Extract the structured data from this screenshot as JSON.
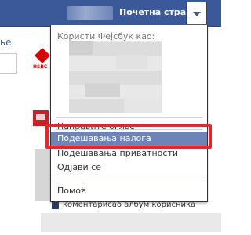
{
  "topbar": {
    "home_label": "Почетна страна",
    "colors": {
      "bar": "#3b5998",
      "text": "#ffffff"
    }
  },
  "left_sidebar": {
    "cut_text": "ье"
  },
  "ad": {
    "logo_text": "HSBC"
  },
  "dropdown": {
    "header": "Користи Фејсбук као:",
    "items": [
      {
        "label": "Направите оглас"
      },
      {
        "label": "Подешавања налога"
      },
      {
        "label": "Подешавања приватности"
      },
      {
        "label": "Одјави се"
      },
      {
        "label": "Помоћ"
      }
    ],
    "active_index": 1,
    "highlight_color": "#e5262d"
  },
  "feed": {
    "story_text": "коментарисао албум корисника"
  }
}
